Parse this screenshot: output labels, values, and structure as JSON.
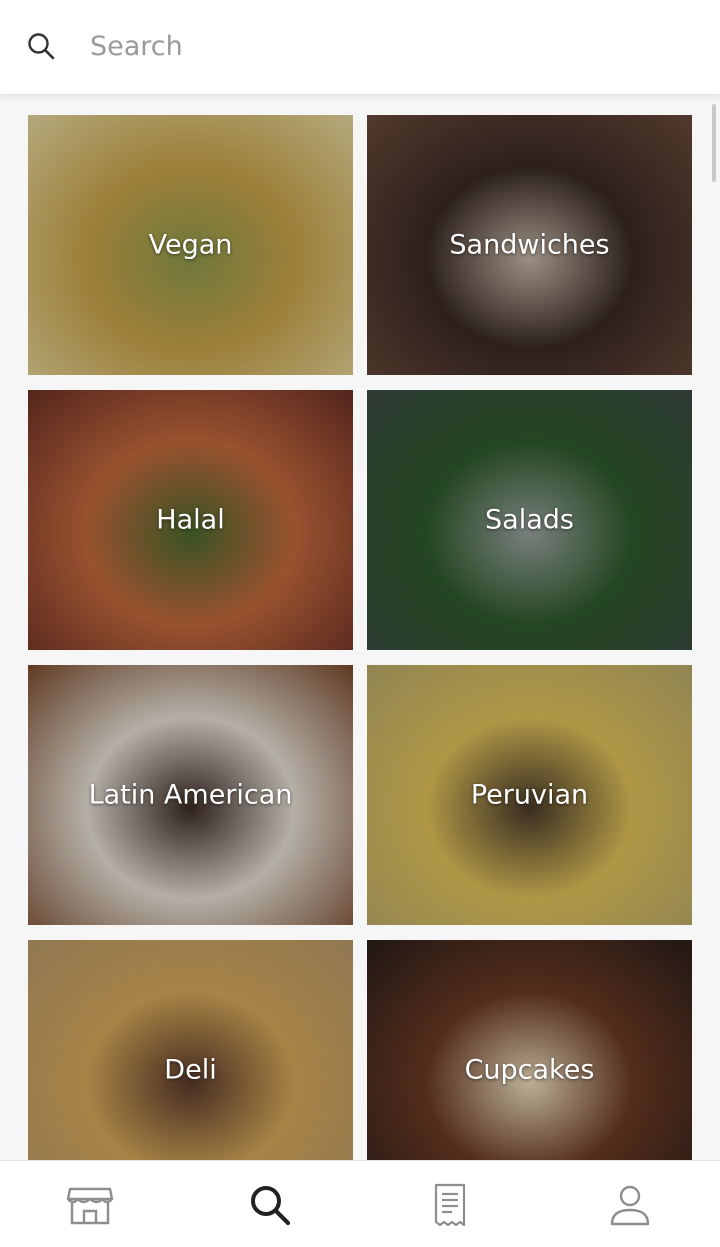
{
  "search": {
    "placeholder": "Search",
    "icon": "search-icon"
  },
  "categories": [
    {
      "label": "Vegan",
      "palette": [
        "#e8d9a0",
        "#c9a44a",
        "#8f9b4c"
      ]
    },
    {
      "label": "Sandwiches",
      "palette": [
        "#6b4a3a",
        "#3a2a24",
        "#c7b8a8"
      ]
    },
    {
      "label": "Halal",
      "palette": [
        "#6b2f25",
        "#c46a3d",
        "#4a6b2e"
      ]
    },
    {
      "label": "Salads",
      "palette": [
        "#3c4a44",
        "#2f5a2c",
        "#9aa4a0"
      ]
    },
    {
      "label": "Latin American",
      "palette": [
        "#7a4a2c",
        "#e7e1d6",
        "#3c2b24"
      ]
    },
    {
      "label": "Peruvian",
      "palette": [
        "#b9aa6a",
        "#e0c25a",
        "#4a3a2a"
      ]
    },
    {
      "label": "Deli",
      "palette": [
        "#b99a6a",
        "#d6a85a",
        "#5a3a2a"
      ]
    },
    {
      "label": "Cupcakes",
      "palette": [
        "#2a1e1a",
        "#6b3a24",
        "#efe0c0"
      ]
    }
  ],
  "bottom_nav": {
    "items": [
      {
        "name": "storefront-icon",
        "active": false
      },
      {
        "name": "search-icon",
        "active": true
      },
      {
        "name": "receipt-icon",
        "active": false
      },
      {
        "name": "profile-icon",
        "active": false
      }
    ]
  },
  "colors": {
    "active": "#222222",
    "inactive": "#8e8e8e",
    "accent": "#ffffff"
  }
}
